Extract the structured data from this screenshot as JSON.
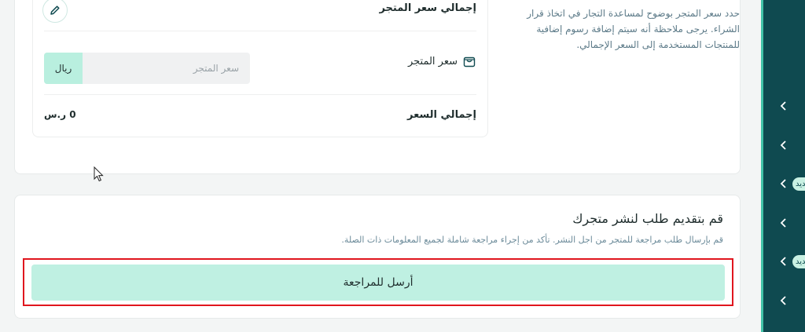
{
  "store_price": {
    "description": "حدد سعر المتجر بوضوح لمساعدة التجار في اتخاذ قرار الشراء. يرجى ملاحظة أنه سيتم إضافة رسوم إضافية للمنتجات المستخدمة إلى السعر الإجمالي.",
    "total_store_price_label": "إجمالي سعر المتجر",
    "store_price_label": "سعر المتجر",
    "store_price_placeholder": "سعر المتجر",
    "store_price_value": "",
    "currency": "ريال",
    "total_price_label": "إجمالي السعر",
    "total_price_value": "0 ر.س"
  },
  "submit_section": {
    "title": "قم بتقديم طلب لنشر متجرك",
    "description": "قم بإرسال طلب مراجعة للمتجر من اجل النشر. تأكد من إجراء مراجعة شاملة لجميع المعلومات ذات الصلة.",
    "button_label": "أرسل للمراجعة"
  },
  "sidebar": {
    "items": [
      {
        "icon": "chevron-left-icon",
        "badge": ""
      },
      {
        "icon": "chevron-left-icon",
        "badge": ""
      },
      {
        "icon": "chevron-left-icon",
        "badge": "جديد"
      },
      {
        "icon": "chevron-left-icon",
        "badge": ""
      },
      {
        "icon": "chevron-left-icon",
        "badge": "جديد"
      },
      {
        "icon": "chevron-left-icon",
        "badge": ""
      }
    ]
  },
  "colors": {
    "sidebar_bg": "#0f4a50",
    "accent": "#43c3a8",
    "button_bg": "#bff0e2",
    "highlight": "#e0161e"
  }
}
